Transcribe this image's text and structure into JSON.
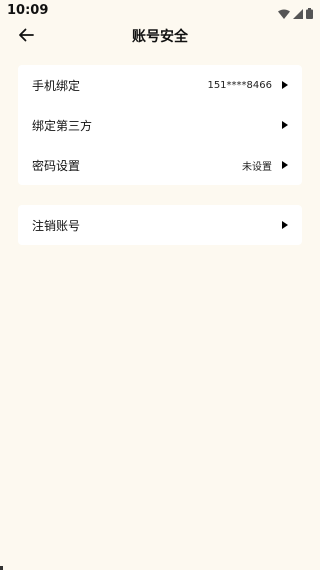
{
  "status_bar": {
    "time": "10:09"
  },
  "header": {
    "title": "账号安全",
    "back_icon": "arrow-left-icon"
  },
  "settings_group": [
    {
      "label": "手机绑定",
      "value": "151****8466"
    },
    {
      "label": "绑定第三方",
      "value": ""
    },
    {
      "label": "密码设置",
      "value": "未设置"
    }
  ],
  "account_group": [
    {
      "label": "注销账号",
      "value": ""
    }
  ],
  "colors": {
    "background": "#fdf9f0",
    "card": "#ffffff",
    "text": "#111111"
  }
}
